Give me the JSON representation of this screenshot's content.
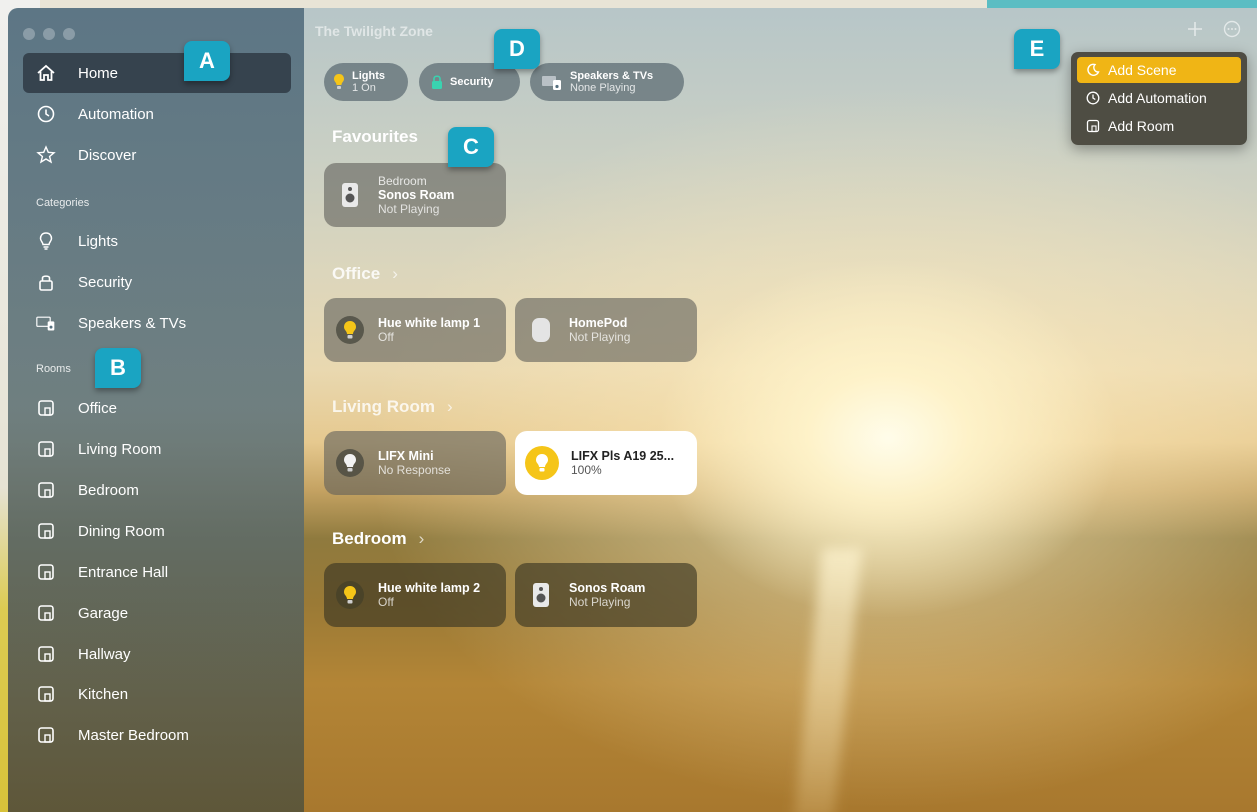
{
  "window": {
    "title": "The Twilight Zone"
  },
  "toolbar": {
    "add_icon": "plus-icon",
    "more_icon": "ellipsis-circle-icon"
  },
  "sidebar": {
    "main_items": [
      {
        "label": "Home",
        "icon": "house-icon",
        "selected": true
      },
      {
        "label": "Automation",
        "icon": "clock-icon"
      },
      {
        "label": "Discover",
        "icon": "star-icon"
      }
    ],
    "categories_header": "Categories",
    "categories": [
      {
        "label": "Lights",
        "icon": "lightbulb-icon"
      },
      {
        "label": "Security",
        "icon": "lock-icon"
      },
      {
        "label": "Speakers & TVs",
        "icon": "tv-speaker-icon"
      }
    ],
    "rooms_header": "Rooms",
    "rooms": [
      "Office",
      "Living Room",
      "Bedroom",
      "Dining Room",
      "Entrance Hall",
      "Garage",
      "Hallway",
      "Kitchen",
      "Master Bedroom"
    ]
  },
  "status_pills": [
    {
      "title": "Lights",
      "subtitle": "1 On",
      "icon": "lightbulb-icon",
      "accent": "#f5c518"
    },
    {
      "title": "Security",
      "subtitle": "",
      "icon": "lock-icon",
      "accent": "#3ad2b0"
    },
    {
      "title": "Speakers & TVs",
      "subtitle": "None Playing",
      "icon": "tv-speaker-icon"
    }
  ],
  "favourites": {
    "title": "Favourites",
    "tiles": [
      {
        "room": "Bedroom",
        "name": "Sonos Roam",
        "status": "Not Playing",
        "icon": "speaker-icon"
      }
    ]
  },
  "rooms_sections": [
    {
      "title": "Office",
      "tiles": [
        {
          "name": "Hue white lamp 1",
          "status": "Off",
          "icon": "lightbulb-icon",
          "on": false
        },
        {
          "name": "HomePod",
          "status": "Not Playing",
          "icon": "homepod-icon",
          "on": false
        }
      ]
    },
    {
      "title": "Living Room",
      "tiles": [
        {
          "name": "LIFX Mini",
          "status": "No Response",
          "icon": "lightbulb-icon",
          "on": false
        },
        {
          "name": "LIFX Pls A19 25...",
          "status": "100%",
          "icon": "lightbulb-icon",
          "on": true
        }
      ]
    },
    {
      "title": "Bedroom",
      "tiles": [
        {
          "name": "Hue white lamp 2",
          "status": "Off",
          "icon": "lightbulb-icon",
          "on": false
        },
        {
          "name": "Sonos Roam",
          "status": "Not Playing",
          "icon": "speaker-icon",
          "on": false
        }
      ]
    }
  ],
  "add_menu": {
    "items": [
      {
        "label": "Add Scene",
        "icon": "scene-icon",
        "highlighted": true
      },
      {
        "label": "Add Automation",
        "icon": "clock-icon"
      },
      {
        "label": "Add Room",
        "icon": "room-icon"
      }
    ]
  },
  "callouts": [
    "A",
    "B",
    "C",
    "D",
    "E"
  ],
  "colors": {
    "callout": "#1aa4c2",
    "menu_highlight": "#f0b515",
    "bulb_on": "#f5c518"
  }
}
